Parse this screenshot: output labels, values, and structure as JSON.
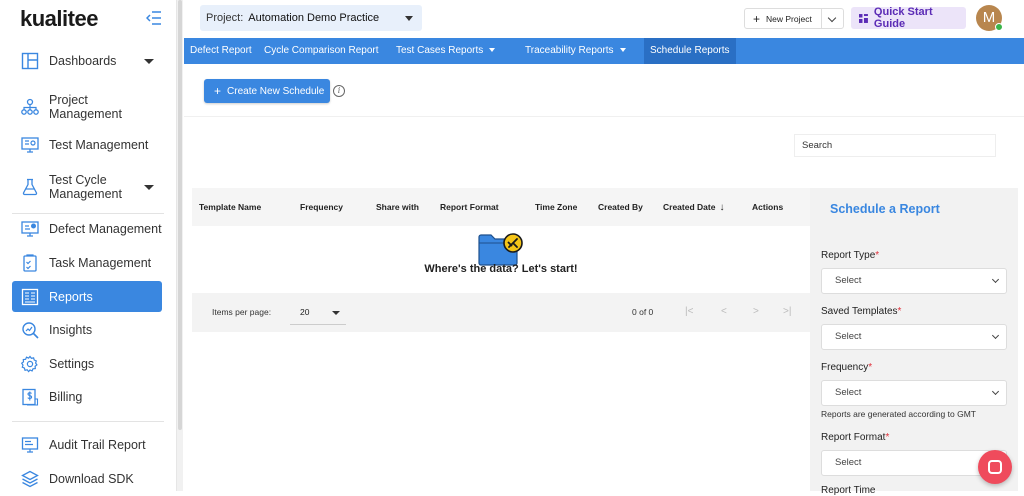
{
  "app": {
    "logo_text": "kualitee"
  },
  "sidebar": {
    "items": [
      {
        "label": "Dashboards",
        "icon": "dashboard-icon",
        "has_caret": true
      },
      {
        "label": "Project\nManagement",
        "icon": "project-hierarchy-icon"
      },
      {
        "label": "Test Management",
        "icon": "monitor-settings-icon"
      },
      {
        "label": "Test Cycle\nManagement",
        "icon": "flask-icon",
        "has_caret": true
      },
      {
        "label": "Defect Management",
        "icon": "bug-monitor-icon"
      },
      {
        "label": "Task Management",
        "icon": "checklist-icon"
      },
      {
        "label": "Reports",
        "icon": "report-icon",
        "active": true
      },
      {
        "label": "Insights",
        "icon": "insights-icon"
      },
      {
        "label": "Settings",
        "icon": "gear-icon"
      },
      {
        "label": "Billing",
        "icon": "dollar-doc-icon"
      },
      {
        "label": "Audit Trail Report",
        "icon": "audit-icon"
      },
      {
        "label": "Download SDK",
        "icon": "layers-icon"
      }
    ]
  },
  "topbar": {
    "project_label": "Project:",
    "project_value": "Automation Demo Practice",
    "new_project_label": "New Project",
    "quick_start_label": "Quick Start Guide",
    "avatar_initial": "M"
  },
  "tabs": [
    {
      "label": "Defect Report"
    },
    {
      "label": "Cycle Comparison Report"
    },
    {
      "label": "Test Cases Reports",
      "dropdown": true
    },
    {
      "label": "Traceability Reports",
      "dropdown": true
    },
    {
      "label": "Schedule Reports",
      "active": true
    }
  ],
  "main": {
    "create_button_label": "Create New Schedule",
    "info_icon_glyph": "i",
    "search_placeholder": "Search",
    "table": {
      "columns": [
        "Template Name",
        "Frequency",
        "Share with",
        "Report Format",
        "Time Zone",
        "Created By",
        "Created Date",
        "Actions"
      ],
      "sorted_column": "Created Date",
      "sort_glyph": "↓",
      "empty_text": "Where's the data? Let's start!"
    },
    "pagination": {
      "items_per_page_label": "Items per page:",
      "page_size": "20",
      "range_text": "0 of 0",
      "first_glyph": "|<",
      "prev_glyph": "<",
      "next_glyph": ">",
      "last_glyph": ">|"
    }
  },
  "schedule_panel": {
    "title": "Schedule a Report",
    "fields": [
      {
        "label": "Report Type",
        "required": true,
        "value": "Select"
      },
      {
        "label": "Saved Templates",
        "required": true,
        "value": "Select"
      },
      {
        "label": "Frequency",
        "required": true,
        "value": "Select",
        "hint": "Reports are generated according to GMT"
      },
      {
        "label": "Report Format",
        "required": true,
        "value": "Select"
      }
    ],
    "required_marker": "*",
    "cut_off_label": "Report Time"
  },
  "colors": {
    "accent": "#3a87e0",
    "tab_active": "#2a6fc4",
    "quick_start_bg": "#ece4f9",
    "quick_start_text": "#5b2bb5",
    "required": "#e0303a",
    "chat": "#ef4b5c",
    "folder": "#3a87e0",
    "badge": "#f5c518"
  }
}
